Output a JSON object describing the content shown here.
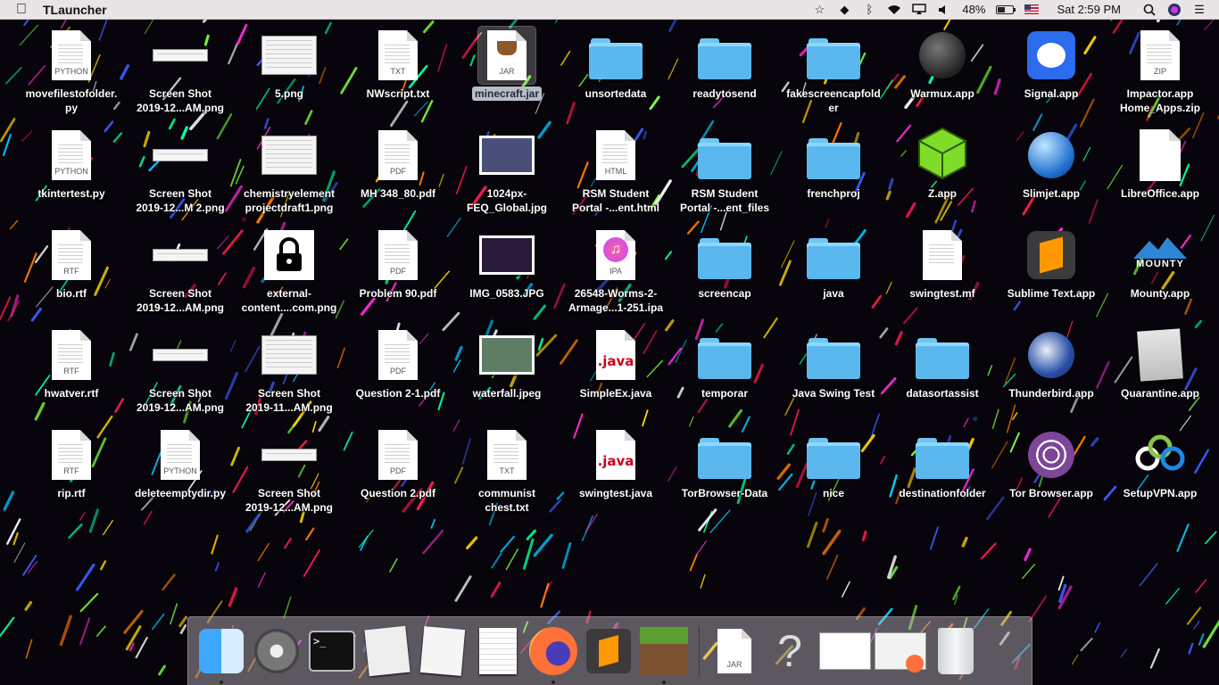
{
  "menubar": {
    "app_name": "TLauncher",
    "battery": "48%",
    "battery_level": 0.48,
    "clock": "Sat 2:59 PM"
  },
  "desktop": {
    "columns": [
      [
        {
          "label": "movefilestofolder.\npy",
          "kind": "doc",
          "tag": "PYTHON"
        },
        {
          "label": "tkintertest.py",
          "kind": "doc",
          "tag": "PYTHON"
        },
        {
          "label": "bio.rtf",
          "kind": "doc",
          "tag": "RTF"
        },
        {
          "label": "hwatver.rtf",
          "kind": "doc",
          "tag": "RTF"
        },
        {
          "label": "rip.rtf",
          "kind": "doc",
          "tag": "RTF"
        }
      ],
      [
        {
          "label": "Screen Shot\n2019-12...AM.png",
          "kind": "thumb-wide"
        },
        {
          "label": "Screen Shot\n2019-12...M 2.png",
          "kind": "thumb-wide"
        },
        {
          "label": "Screen Shot\n2019-12...AM.png",
          "kind": "thumb-wide"
        },
        {
          "label": "Screen Shot\n2019-12...AM.png",
          "kind": "thumb-wide"
        },
        {
          "label": "deleteemptydir.py",
          "kind": "doc",
          "tag": "PYTHON"
        }
      ],
      [
        {
          "label": "5.png",
          "kind": "thumb"
        },
        {
          "label": "chemistryelement\nprojectdraft1.png",
          "kind": "thumb"
        },
        {
          "label": "external-\ncontent....com.png",
          "kind": "lock"
        },
        {
          "label": "Screen Shot\n2019-11...AM.png",
          "kind": "thumb"
        },
        {
          "label": "Screen Shot\n2019-12...AM.png",
          "kind": "thumb-wide"
        }
      ],
      [
        {
          "label": "NWscript.txt",
          "kind": "doc",
          "tag": "TXT"
        },
        {
          "label": "MH 348_80.pdf",
          "kind": "doc",
          "tag": "PDF"
        },
        {
          "label": "Problem 90.pdf",
          "kind": "doc",
          "tag": "PDF"
        },
        {
          "label": "Question 2-1.pdf",
          "kind": "doc",
          "tag": "PDF"
        },
        {
          "label": "Question 2.pdf",
          "kind": "doc",
          "tag": "PDF"
        }
      ],
      [
        {
          "label": "minecraft.jar",
          "kind": "jar",
          "tag": "JAR",
          "selected": true
        },
        {
          "label": "1024px-\nFEQ_Global.jpg",
          "kind": "photo",
          "color": "#4a4f7a"
        },
        {
          "label": "IMG_0583.JPG",
          "kind": "photo",
          "color": "#2a1a3a"
        },
        {
          "label": "waterfall.jpeg",
          "kind": "photo",
          "color": "#5f7d64"
        },
        {
          "label": "communist\nchest.txt",
          "kind": "doc",
          "tag": "TXT"
        }
      ],
      [
        {
          "label": "unsortedata",
          "kind": "folder"
        },
        {
          "label": "RSM Student\nPortal -...ent.html",
          "kind": "doc",
          "tag": "HTML"
        },
        {
          "label": "26548-Worms-2-\nArmage...1-251.ipa",
          "kind": "ipa",
          "tag": "IPA"
        },
        {
          "label": "SimpleEx.java",
          "kind": "java",
          "tag": ".java"
        },
        {
          "label": "swingtest.java",
          "kind": "java",
          "tag": ".java"
        }
      ],
      [
        {
          "label": "readytosend",
          "kind": "folder"
        },
        {
          "label": "RSM Student\nPortal -...ent_files",
          "kind": "folder"
        },
        {
          "label": "screencap",
          "kind": "folder"
        },
        {
          "label": "temporar",
          "kind": "folder"
        },
        {
          "label": "TorBrowser-Data",
          "kind": "folder"
        }
      ],
      [
        {
          "label": "fakescreencapfold\ner",
          "kind": "folder"
        },
        {
          "label": "frenchproj",
          "kind": "folder"
        },
        {
          "label": "java",
          "kind": "folder"
        },
        {
          "label": "Java Swing Test",
          "kind": "folder"
        },
        {
          "label": "nice",
          "kind": "folder"
        }
      ],
      [
        {
          "label": "Warmux.app",
          "kind": "app",
          "icon": "warmux"
        },
        {
          "label": "Z.app",
          "kind": "app",
          "icon": "cube"
        },
        {
          "label": "swingtest.mf",
          "kind": "doc",
          "tag": ""
        },
        {
          "label": "datasortassist",
          "kind": "folder"
        },
        {
          "label": "destinationfolder",
          "kind": "folder"
        }
      ],
      [
        {
          "label": "Signal.app",
          "kind": "app",
          "icon": "signal"
        },
        {
          "label": "Slimjet.app",
          "kind": "app",
          "icon": "globe"
        },
        {
          "label": "Sublime Text.app",
          "kind": "app",
          "icon": "sublime"
        },
        {
          "label": "Thunderbird.app",
          "kind": "app",
          "icon": "thunderbird"
        },
        {
          "label": "Tor Browser.app",
          "kind": "app",
          "icon": "tor"
        }
      ],
      [
        {
          "label": "Impactor.app\nHome_Apps.zip",
          "kind": "doc",
          "tag": "ZIP"
        },
        {
          "label": "LibreOffice.app",
          "kind": "app",
          "icon": "libreoffice"
        },
        {
          "label": "Mounty.app",
          "kind": "app",
          "icon": "mounty",
          "icon_text": "MOUNTY"
        },
        {
          "label": "Quarantine.app",
          "kind": "app",
          "icon": "quarantine"
        },
        {
          "label": "SetupVPN.app",
          "kind": "app",
          "icon": "vpn"
        }
      ]
    ]
  },
  "dock": {
    "items": [
      {
        "name": "finder-icon",
        "running": true
      },
      {
        "name": "system-preferences-icon",
        "running": false
      },
      {
        "name": "terminal-icon",
        "running": false,
        "text": ">_"
      },
      {
        "name": "script-editor-icon",
        "running": false
      },
      {
        "name": "text-editor-icon",
        "running": false
      },
      {
        "name": "textedit-icon",
        "running": false
      },
      {
        "name": "firefox-icon",
        "running": true
      },
      {
        "name": "sublime-text-icon",
        "running": false
      },
      {
        "name": "minecraft-icon",
        "running": true
      },
      {
        "separator": true
      },
      {
        "name": "jar-icon",
        "running": false,
        "tag": "JAR"
      },
      {
        "name": "question-mark-icon",
        "running": false,
        "text": "?"
      },
      {
        "name": "finder-window-preview-icon",
        "running": false
      },
      {
        "name": "firefox-window-preview-icon",
        "running": false
      },
      {
        "name": "trash-icon",
        "running": false
      }
    ]
  }
}
